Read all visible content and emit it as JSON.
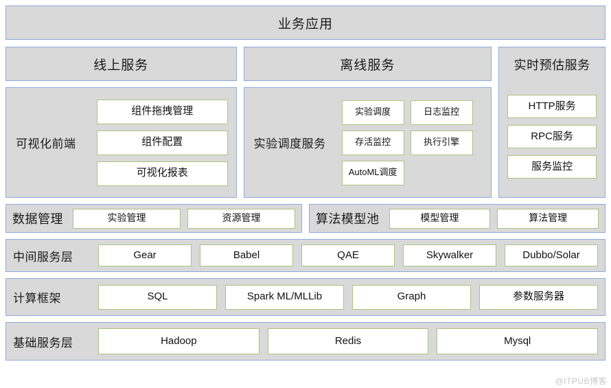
{
  "colors": {
    "panel_fill": "#d9d9d9",
    "panel_border": "#8faadc",
    "chip_fill": "#ffffff",
    "chip_border": "#a9c47f",
    "text": "#111111",
    "watermark": "#c9c9c9"
  },
  "app_layer": {
    "title": "业务应用"
  },
  "services": {
    "online": {
      "header": "线上服务",
      "group_label": "可视化前端",
      "items": [
        "组件拖拽管理",
        "组件配置",
        "可视化报表"
      ]
    },
    "offline": {
      "header": "离线服务",
      "group_label": "实验调度服务",
      "items": [
        "实验调度",
        "日志监控",
        "存活监控",
        "执行引擎",
        "AutoML调度"
      ]
    },
    "realtime": {
      "header": "实时预估服务",
      "items": [
        "HTTP服务",
        "RPC服务",
        "服务监控"
      ]
    }
  },
  "management_row": [
    {
      "label": "数据管理",
      "items": [
        "实验管理",
        "资源管理"
      ]
    },
    {
      "label": "算法模型池",
      "items": [
        "模型管理",
        "算法管理"
      ]
    }
  ],
  "layers": [
    {
      "label": "中间服务层",
      "items": [
        "Gear",
        "Babel",
        "QAE",
        "Skywalker",
        "Dubbo/Solar"
      ]
    },
    {
      "label": "计算框架",
      "items": [
        "SQL",
        "Spark ML/MLLib",
        "Graph",
        "参数服务器"
      ]
    },
    {
      "label": "基础服务层",
      "items": [
        "Hadoop",
        "Redis",
        "Mysql"
      ]
    }
  ],
  "watermark": "@ITPUB博客"
}
